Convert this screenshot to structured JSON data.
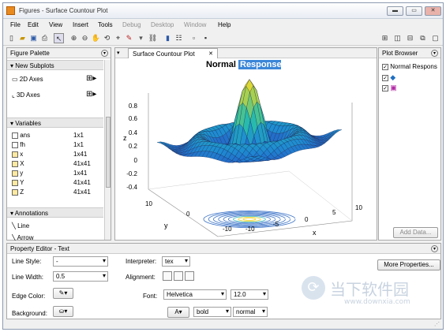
{
  "window": {
    "title": "Figures - Surface Countour Plot"
  },
  "window_buttons": {
    "minimize": "▬",
    "restore": "▭",
    "close": "✕"
  },
  "menu": [
    "File",
    "Edit",
    "View",
    "Insert",
    "Tools",
    "Debug",
    "Desktop",
    "Window",
    "Help"
  ],
  "figure_palette": {
    "title": "Figure Palette",
    "new_subplots": {
      "header": "New Subplots",
      "items": [
        "2D Axes",
        "3D Axes"
      ]
    },
    "variables": {
      "header": "Variables",
      "items": [
        {
          "name": "ans",
          "size": "1x1"
        },
        {
          "name": "fh",
          "size": "1x1"
        },
        {
          "name": "x",
          "size": "1x41"
        },
        {
          "name": "X",
          "size": "41x41"
        },
        {
          "name": "y",
          "size": "1x41"
        },
        {
          "name": "Y",
          "size": "41x41"
        },
        {
          "name": "Z",
          "size": "41x41"
        }
      ]
    },
    "annotations": {
      "header": "Annotations",
      "items": [
        "Line",
        "Arrow"
      ]
    }
  },
  "tab": {
    "label": "Surface Countour Plot",
    "close": "✕"
  },
  "plot": {
    "title_normal": "Normal",
    "title_selected": "Response",
    "zlabel": "z",
    "ylabel": "y",
    "xlabel": "x",
    "zticks": [
      "0.8",
      "0.6",
      "0.4",
      "0.2",
      "0",
      "-0.2",
      "-0.4"
    ],
    "yticks": [
      "10",
      "0",
      "-10"
    ],
    "xticks": [
      "-10",
      "-5",
      "0",
      "5",
      "10"
    ]
  },
  "plot_browser": {
    "title": "Plot Browser",
    "items": [
      "Normal Respons",
      "",
      ""
    ],
    "add_data": "Add Data..."
  },
  "property_editor": {
    "title": "Property Editor - Text",
    "line_style_label": "Line Style:",
    "line_style": "-",
    "line_width_label": "Line Width:",
    "line_width": "0.5",
    "edge_color_label": "Edge Color:",
    "background_label": "Background:",
    "interpreter_label": "Interpreter:",
    "interpreter": "tex",
    "alignment_label": "Alignment:",
    "font_label": "Font:",
    "font": "Helvetica",
    "font_size": "12.0",
    "font_weight": "bold",
    "font_angle": "normal",
    "more_properties": "More Properties..."
  },
  "watermark": {
    "cn": "当下软件园",
    "url": "www.downxia.com"
  }
}
